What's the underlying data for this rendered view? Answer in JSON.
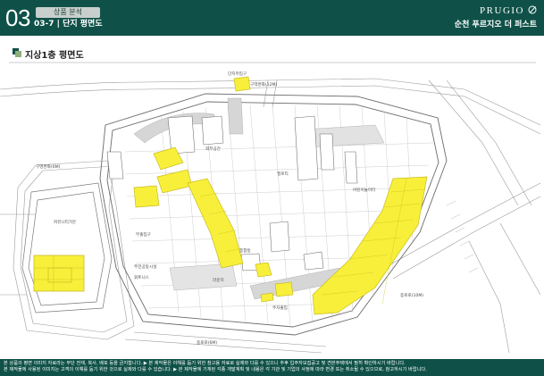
{
  "header": {
    "section_number": "03",
    "category": "상품 분석",
    "page_subtitle": "03-7 | 단지 평면도",
    "brand": "PRUGIO",
    "complex_name": "순천 푸르지오 더 퍼스트"
  },
  "title": {
    "floor_plan": "지상1층 평면도"
  },
  "plan": {
    "labels": {
      "road_12m": "구역완화(12M)",
      "road_6m": "구영완화(6M)",
      "road_10m": "종로로(10M)",
      "road_6m_b": "종로로(6M)",
      "bus_stop": "단지주입구",
      "parking_entry": "주차출입",
      "main_gate": "종합동",
      "kids_area": "어린이놀이터",
      "community": "주민공동시설",
      "fitness": "휘트니스",
      "yard": "외부공간",
      "lounge": "라운지",
      "pilotis": "필로티",
      "entry_sub": "부출입구",
      "grove": "커뮤니티가든"
    },
    "colors": {
      "highlight": "#f8ef3a",
      "highlight_stroke": "#c8bd20",
      "line": "#8a8a8a",
      "header_bg": "#0f5148"
    }
  },
  "footer": {
    "line1": "본 상품의 평면 이미지 자료라는 무단 전재, 복사, 배포 등을 금지합니다. ▶ 본 제작물은 이해를 돕기 위한 참고용 자료로 실제와 다를 수 있으니 추후 입주자모집공고 및 견본주택에서 필히 확인하시기 바랍니다.",
    "line2": "본 제작물에 사용된 이미지는 고객의 이해를 돕기 위한 것으로 실제와 다를 수 있습니다. ▶ 본 제작물에 기재된 각종 개발계획 및 내용은 각 기관 및 기업의 사정에 따라 변경 또는 취소될 수 있으므로, 참고하시기 바랍니다."
  }
}
